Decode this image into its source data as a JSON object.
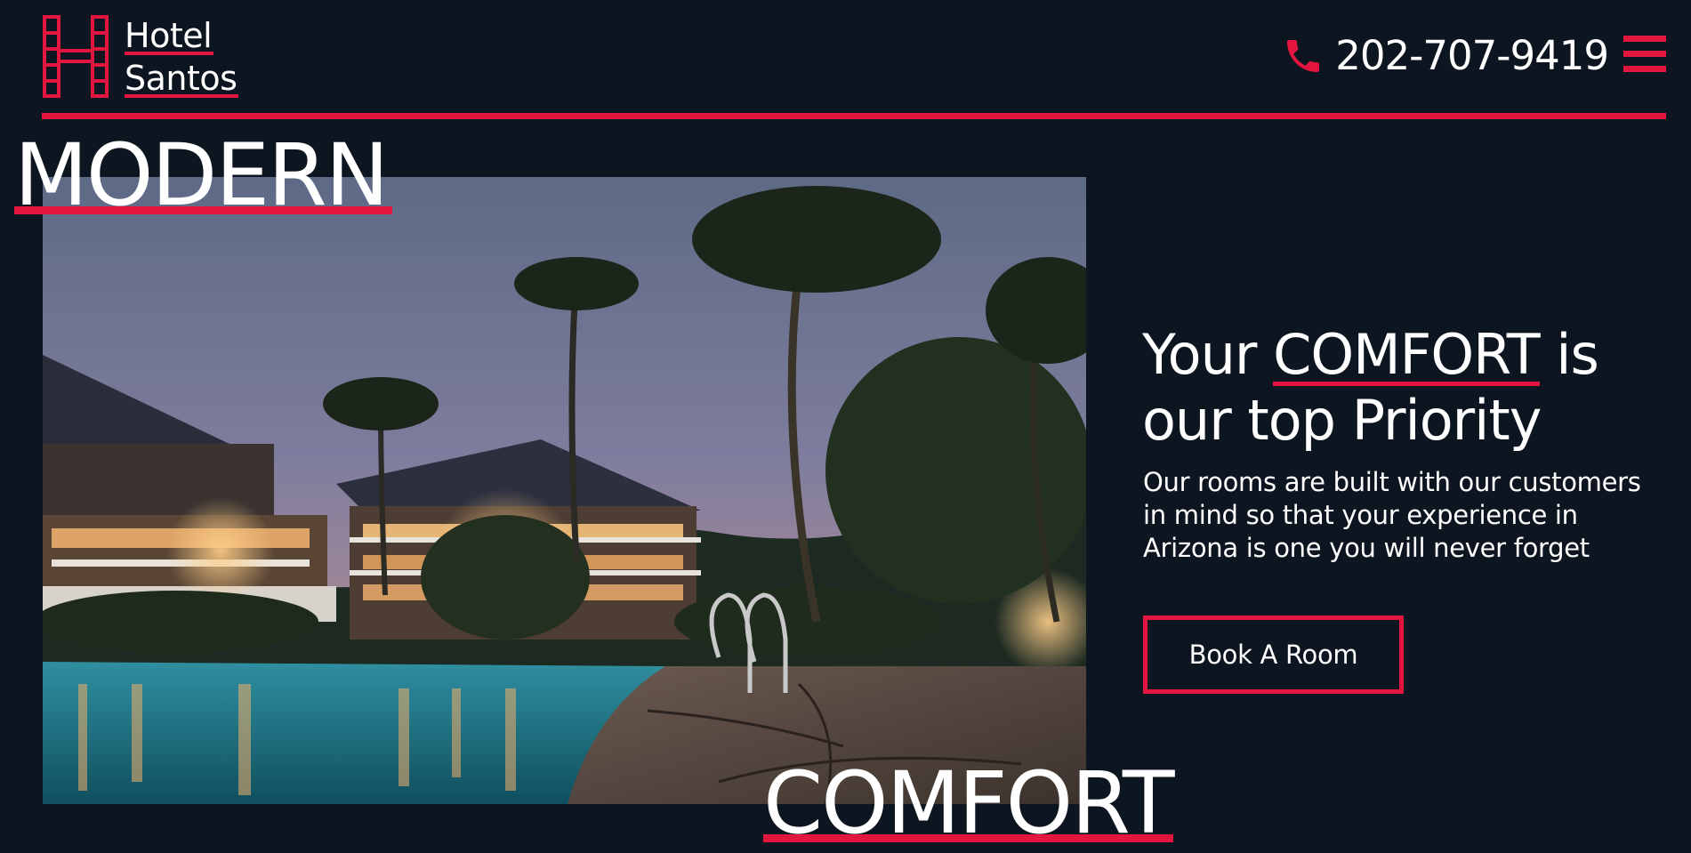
{
  "brand": {
    "name_line1": "Hotel",
    "name_line2": "Santos",
    "logo_icon": "hotel-h-ladder-logo"
  },
  "header": {
    "phone_icon": "phone-icon",
    "phone_number": "202-707-9419",
    "menu_icon": "hamburger-menu-icon"
  },
  "hero": {
    "image_subject": "resort-pool-palm-trees-dusk",
    "word_top": "MODERN",
    "word_bottom": "COMFORT"
  },
  "main": {
    "headline_part1": "Your",
    "headline_accent": "COMFORT",
    "headline_part2": "is our top Priority",
    "description": "Our rooms are built with our customers in mind so that your experience in Arizona is one you will never forget",
    "cta_label": "Book A Room"
  },
  "colors": {
    "background": "#0d1620",
    "accent": "#e3163f",
    "text": "#ffffff"
  }
}
